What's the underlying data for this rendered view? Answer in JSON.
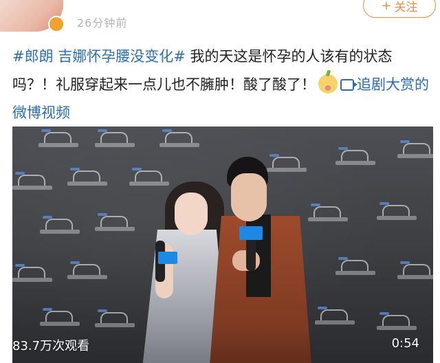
{
  "header": {
    "time": "26分钟前",
    "follow_label": "关注",
    "follow_icon": "plus-icon"
  },
  "post": {
    "topic": "#郎朗 吉娜怀孕腰没变化#",
    "text": " 我的天这是怀孕的人该有的状态吗？！礼服穿起来一点儿也不臃肿！酸了酸了！",
    "emoji": "lemon-emoji",
    "video_link_label": "追剧大赏的微博视频"
  },
  "video": {
    "views": "83.7万次观看",
    "duration": "0:54"
  },
  "colors": {
    "link": "#2b6ead",
    "follow": "#f28d3c"
  }
}
